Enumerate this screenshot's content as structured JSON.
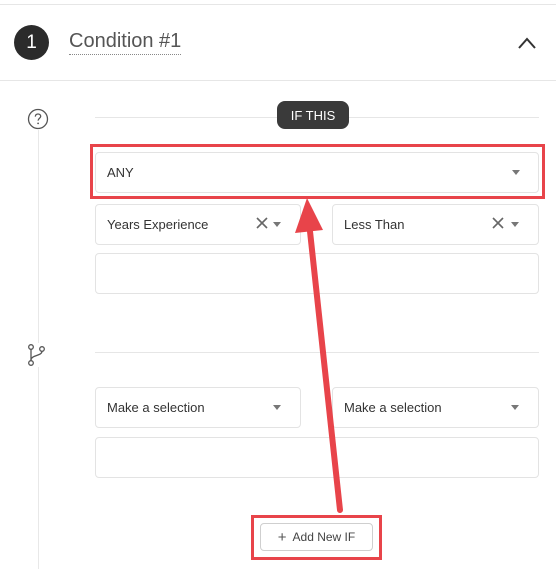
{
  "condition": {
    "step_number": "1",
    "title": "Condition #1"
  },
  "if_section": {
    "label": "IF THIS",
    "match_select": {
      "value": "ANY"
    },
    "rule_1": {
      "field_select": {
        "value": "Years Experience"
      },
      "operator_select": {
        "value": "Less Than"
      }
    },
    "rule_2": {
      "field_select": {
        "value": "Make a selection"
      },
      "operator_select": {
        "value": "Make a selection"
      }
    },
    "add_button": {
      "label": "Add New IF"
    }
  },
  "icons": {
    "step": "circle-number",
    "collapse": "chevron-up-icon",
    "help": "question-circle-icon",
    "branch": "git-branch-icon",
    "clear": "x-icon",
    "dropdown": "caret-down-icon",
    "add": "plus-icon"
  },
  "annotations": {
    "color": "#e8444a"
  }
}
